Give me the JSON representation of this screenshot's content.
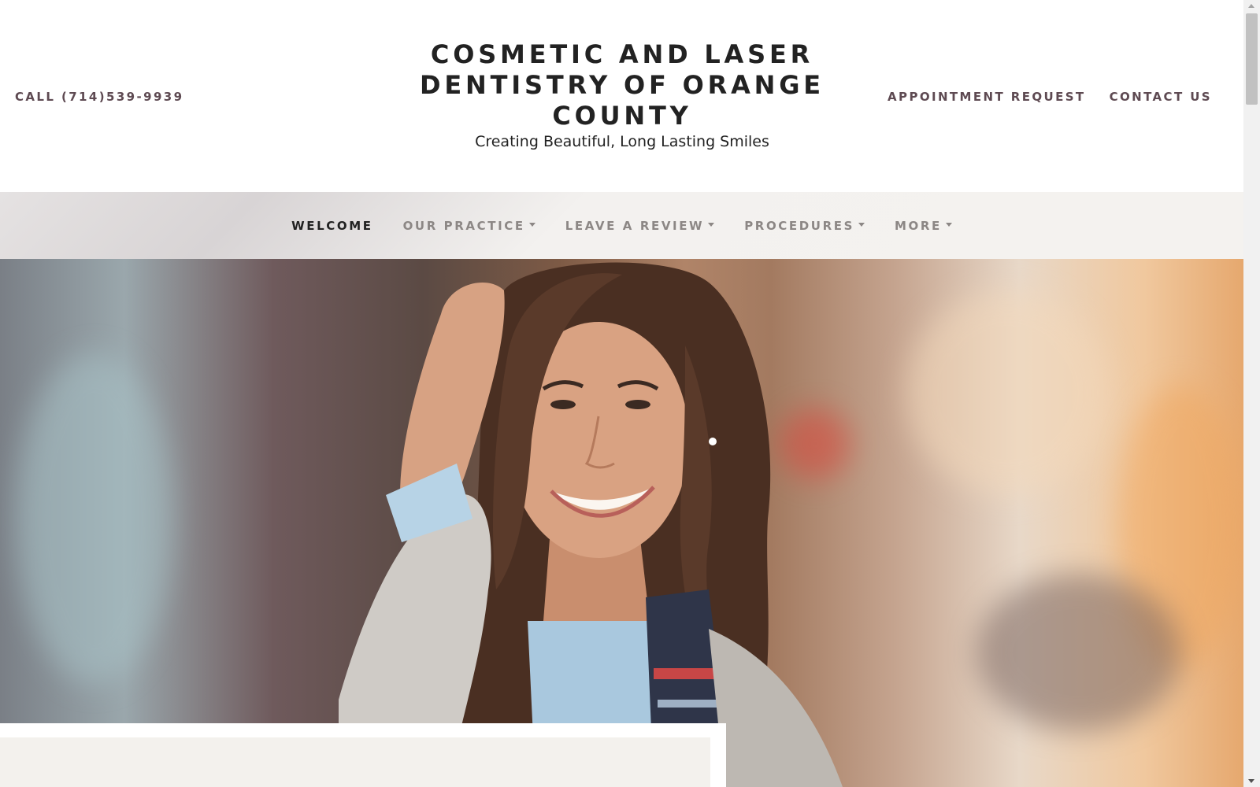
{
  "header": {
    "call_label": "CALL (714)539-9939",
    "title": "COSMETIC AND LASER DENTISTRY OF ORANGE COUNTY",
    "tagline": "Creating Beautiful, Long Lasting Smiles",
    "appointment_label": "APPOINTMENT REQUEST",
    "contact_label": "CONTACT US"
  },
  "nav": {
    "items": [
      {
        "label": "WELCOME",
        "active": true,
        "has_dropdown": false
      },
      {
        "label": "OUR PRACTICE",
        "active": false,
        "has_dropdown": true
      },
      {
        "label": "LEAVE A REVIEW",
        "active": false,
        "has_dropdown": true
      },
      {
        "label": "PROCEDURES",
        "active": false,
        "has_dropdown": true
      },
      {
        "label": "MORE",
        "active": false,
        "has_dropdown": true
      }
    ]
  },
  "hero": {
    "image": "smiling-woman-photo"
  },
  "colors": {
    "link": "#5e4a52",
    "nav_inactive": "#8c8785",
    "nav_active": "#222222",
    "nav_background": "#f3f1ef",
    "card_background": "#f3f1ed"
  }
}
